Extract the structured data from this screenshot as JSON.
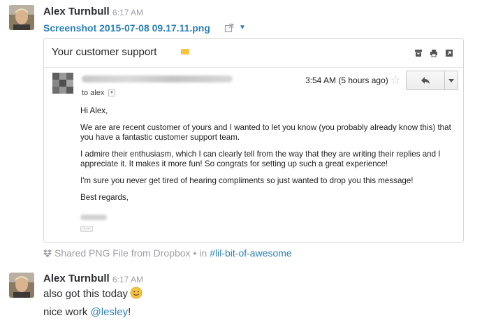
{
  "messages": [
    {
      "author": "Alex Turnbull",
      "time": "6:17 AM",
      "file_name": "Screenshot 2015-07-08 09.17.11.png",
      "preview": {
        "subject": "Your customer support",
        "to": "to alex",
        "mail_time": "3:54 AM (5 hours ago)",
        "body": [
          "Hi Alex,",
          "We are are recent customer of yours and I wanted to let you know (you probably already know this) that you have a fantastic customer support team.",
          "I admire their enthusiasm, which I can clearly tell from the way that they are writing their replies and I appreciate it. It makes it more fun! So congrats for setting up such a great experience!",
          "I'm sure you never get tired of hearing compliments so just wanted to drop you this message!",
          "Best regards,"
        ]
      },
      "shared": {
        "text": "Shared PNG File from Dropbox",
        "dot": "•",
        "in": "in",
        "channel": "#lil-bit-of-awesome"
      }
    },
    {
      "author": "Alex Turnbull",
      "time": "6:17 AM",
      "text": "also got this today",
      "line2_prefix": "nice work ",
      "mention": "@lesley",
      "line2_suffix": "!"
    }
  ],
  "colors": {
    "link": "#2a80b9",
    "muted": "#9e9ea6",
    "label_tag": "#f4c542"
  },
  "icons": {
    "external": "external-link-icon",
    "caret": "caret-down-icon",
    "dropbox": "dropbox-icon",
    "emoji": "slightly-smiling-emoji"
  }
}
